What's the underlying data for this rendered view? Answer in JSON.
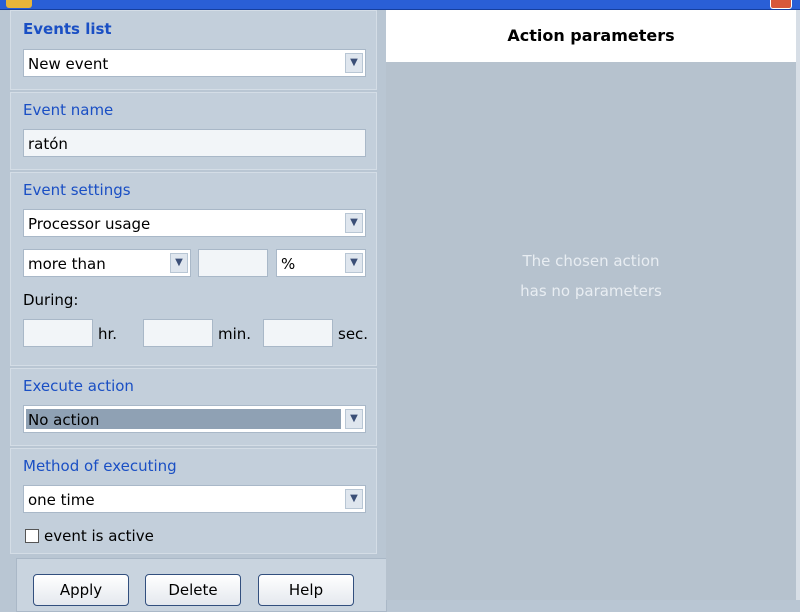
{
  "events_list": {
    "title": "Events list",
    "selected": "New event"
  },
  "event_name": {
    "title": "Event name",
    "value": "ratón"
  },
  "event_settings": {
    "title": "Event settings",
    "type": "Processor usage",
    "comparison": "more than",
    "threshold_value": "",
    "unit": "%",
    "during_label": "During:",
    "hours_value": "",
    "hours_label": "hr.",
    "minutes_value": "",
    "minutes_label": "min.",
    "seconds_value": "",
    "seconds_label": "sec."
  },
  "execute_action": {
    "title": "Execute action",
    "selected": "No action"
  },
  "method_of_executing": {
    "title": "Method of executing",
    "selected": "one time",
    "active_label": "event is active",
    "active_checked": false
  },
  "buttons": {
    "apply": "Apply",
    "delete": "Delete",
    "help": "Help"
  },
  "action_parameters": {
    "title": "Action parameters",
    "message_line1": "The chosen action",
    "message_line2": "has no parameters"
  },
  "icons": {
    "dropdown": "chevron-down-icon",
    "app": "app-icon",
    "close": "close-icon"
  },
  "colors": {
    "window_bg": "#b9c6d3",
    "group_title": "#1a4fc4",
    "selection": "#8fa1b4"
  }
}
